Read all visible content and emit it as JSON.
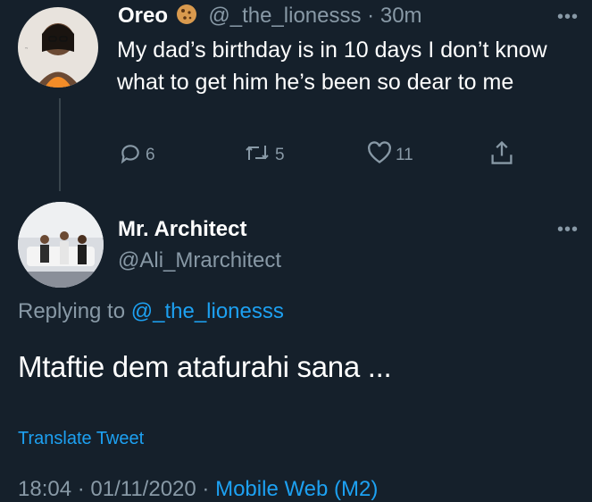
{
  "tweet1": {
    "display_name": "Oreo",
    "name_emoji": "cookie",
    "handle": "@_the_lionesss",
    "time": "30m",
    "body": "My dad’s birthday is in 10 days I don’t know what to get him he’s been so dear to me",
    "more": "•••",
    "actions": {
      "reply_count": "6",
      "retweet_count": "5",
      "like_count": "11"
    }
  },
  "tweet2": {
    "display_name": "Mr. Architect",
    "handle": "@Ali_Mrarchitect",
    "more": "•••",
    "replying_prefix": "Replying to",
    "replying_handle": "@_the_lionesss",
    "body": "Mtaftie dem atafurahi sana ...",
    "translate": "Translate Tweet",
    "time": "18:04",
    "date": "01/11/2020",
    "source": "Mobile Web (M2)"
  },
  "colors": {
    "background": "#15202b",
    "text": "#ffffff",
    "muted": "#8899a6",
    "accent": "#1da1f2"
  }
}
